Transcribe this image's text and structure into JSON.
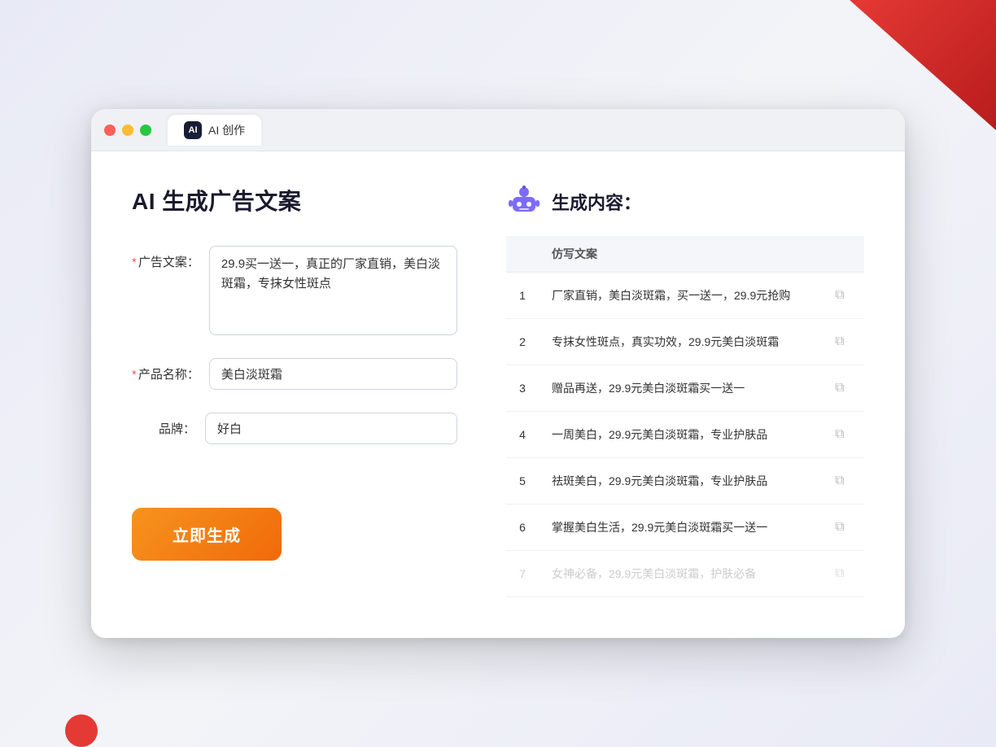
{
  "window": {
    "tab_label": "AI 创作",
    "tab_icon": "AI"
  },
  "left_panel": {
    "title": "AI 生成广告文案",
    "form": {
      "ad_copy_label": "广告文案：",
      "ad_copy_required": true,
      "ad_copy_value": "29.9买一送一，真正的厂家直销，美白淡斑霜，专抹女性斑点",
      "product_label": "产品名称：",
      "product_required": true,
      "product_value": "美白淡斑霜",
      "brand_label": "品牌：",
      "brand_required": false,
      "brand_value": "好白"
    },
    "generate_button": "立即生成"
  },
  "right_panel": {
    "header_title": "生成内容：",
    "table_header": "仿写文案",
    "results": [
      {
        "num": 1,
        "text": "厂家直销，美白淡斑霜，买一送一，29.9元抢购"
      },
      {
        "num": 2,
        "text": "专抹女性斑点，真实功效，29.9元美白淡斑霜"
      },
      {
        "num": 3,
        "text": "赠品再送，29.9元美白淡斑霜买一送一"
      },
      {
        "num": 4,
        "text": "一周美白，29.9元美白淡斑霜，专业护肤品"
      },
      {
        "num": 5,
        "text": "祛斑美白，29.9元美白淡斑霜，专业护肤品"
      },
      {
        "num": 6,
        "text": "掌握美白生活，29.9元美白淡斑霜买一送一"
      },
      {
        "num": 7,
        "text": "女神必备，29.9元美白淡斑霜，护肤必备",
        "faded": true
      }
    ]
  },
  "colors": {
    "orange": "#f7931e",
    "purple": "#6c63ff",
    "red": "#e53935"
  }
}
